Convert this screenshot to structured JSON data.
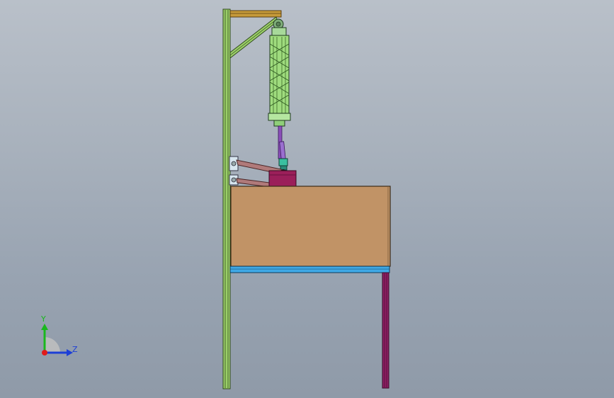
{
  "viewport": {
    "background_top": "#b9c0c9",
    "background_bottom": "#8f9aa8"
  },
  "model": {
    "parts": [
      "vertical-post",
      "top-arm",
      "diagonal-brace",
      "pneumatic-cylinder",
      "piston-rod",
      "lever-links",
      "pivot-block",
      "workbench-box",
      "table-top-beam",
      "table-leg"
    ],
    "colors": {
      "post": "#9ccf6a",
      "post_edge": "#2f4a1c",
      "top_arm": "#c69a3a",
      "cylinder": "#9fdc7e",
      "rod": "#8a4fb8",
      "links": "#b07a7a",
      "block": "#9b1f5a",
      "box": "#c19366",
      "beam": "#3fa9e6",
      "leg": "#8e1f63"
    }
  },
  "triad": {
    "y_label": "Y",
    "z_label": "Z",
    "y_color": "#19b81d",
    "z_color": "#1d3fd6",
    "x_color": "#e01b1b"
  }
}
